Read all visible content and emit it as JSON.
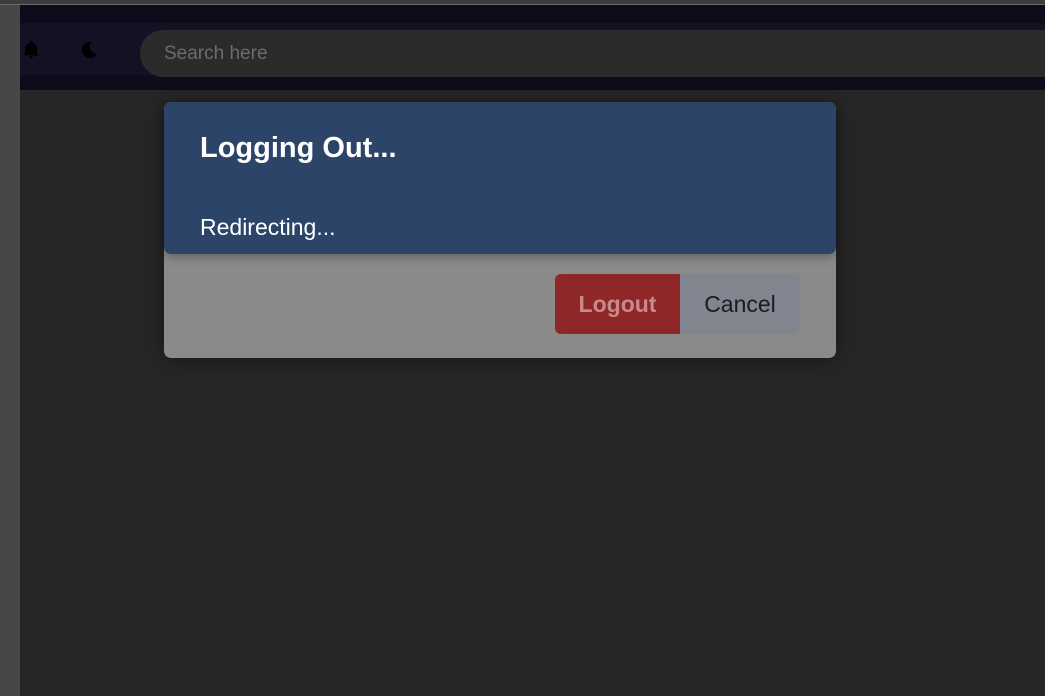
{
  "header": {
    "bell_icon": "bell-icon",
    "theme_icon": "moon-icon",
    "search_placeholder": "Search here",
    "search_value": ""
  },
  "logout_dialog": {
    "logout_label": "Logout",
    "cancel_label": "Cancel"
  },
  "toast": {
    "title": "Logging Out...",
    "message": "Redirecting..."
  },
  "colors": {
    "header_bg": "#0d0b1c",
    "toast_bg": "#2c4468",
    "logout_bg": "#8f2628",
    "cancel_bg": "#828590"
  }
}
